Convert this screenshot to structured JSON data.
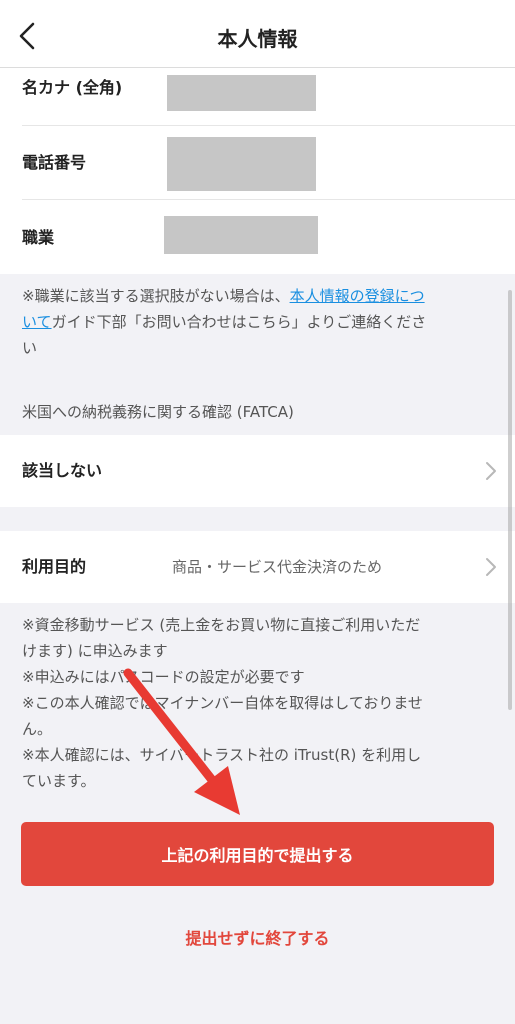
{
  "header": {
    "title": "本人情報"
  },
  "info": [
    {
      "label": "名カナ (全角)"
    },
    {
      "label": "電話番号"
    },
    {
      "label": "職業"
    }
  ],
  "note": {
    "prefix": "※職業に該当する選択肢がない場合は、",
    "link": "本人情報の登録につ",
    "link2": "いて",
    "rest1": "ガイド下部「お問い合わせはこちら」よりご連絡くださ",
    "rest2": "い"
  },
  "fatca": {
    "section": "米国への納税義務に関する確認 (FATCA)",
    "value": "該当しない"
  },
  "purpose": {
    "label": "利用目的",
    "value": "商品・サービス代金決済のため"
  },
  "bullets": [
    "※資金移動サービス (売上金をお買い物に直接ご利用いただ",
    "けます) に申込みます",
    "※申込みにはパスコードの設定が必要です",
    "※この本人確認ではマイナンバー自体を取得はしておりませ",
    "ん。",
    "※本人確認には、サイバートラスト社の iTrust(R) を利用し",
    "ています。"
  ],
  "actions": {
    "submit": "上記の利用目的で提出する",
    "exit": "提出せずに終了する"
  },
  "colors": {
    "accent": "#e2473c",
    "link": "#1a8fe0"
  }
}
